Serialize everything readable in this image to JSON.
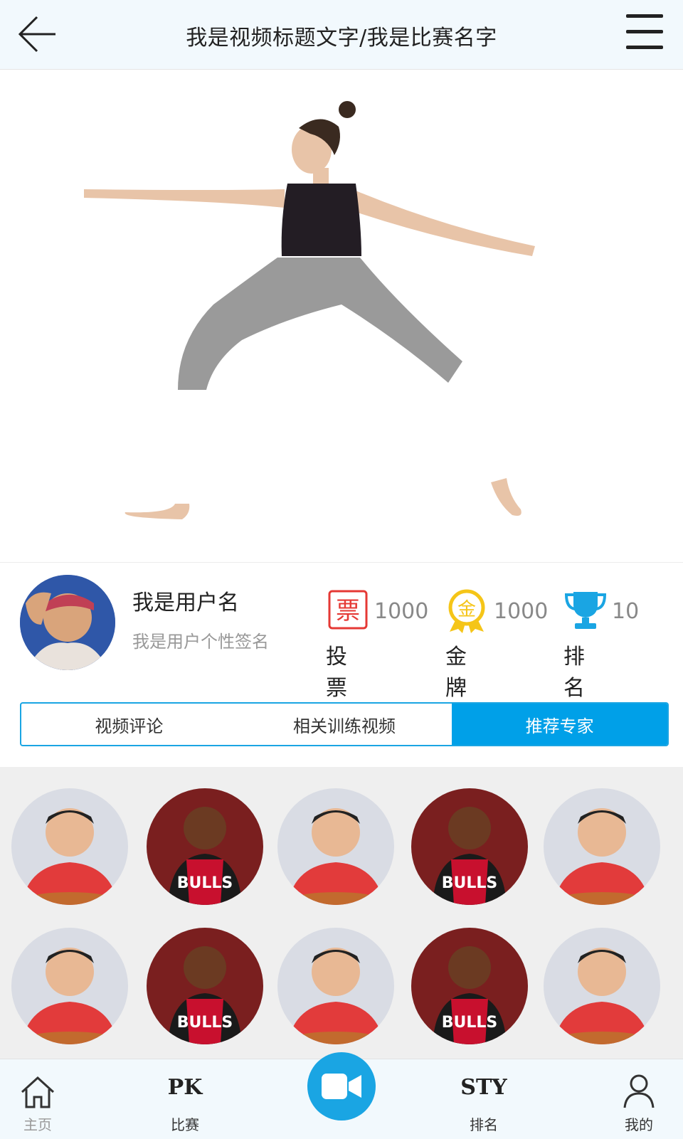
{
  "header": {
    "title": "我是视频标题文字/我是比赛名字",
    "back_icon": "arrow-left-icon",
    "menu_icon": "hamburger-menu-icon"
  },
  "user": {
    "name": "我是用户名",
    "signature": "我是用户个性签名"
  },
  "stats": {
    "votes": {
      "icon": "ticket-icon",
      "value": "1000",
      "label": "投票"
    },
    "gold": {
      "icon": "gold-medal-icon",
      "value": "1000",
      "label": "金牌"
    },
    "rank": {
      "icon": "trophy-icon",
      "value": "10",
      "label": "排名"
    }
  },
  "tabs": [
    {
      "label": "视频评论",
      "active": false
    },
    {
      "label": "相关训练视频",
      "active": false
    },
    {
      "label": "推荐专家",
      "active": true
    }
  ],
  "nav": {
    "home": {
      "label": "主页",
      "icon": "home-icon"
    },
    "pk": {
      "big": "PK",
      "label": "比赛"
    },
    "record": {
      "icon": "video-camera-icon"
    },
    "sty": {
      "big": "STY",
      "label": "排名"
    },
    "me": {
      "label": "我的",
      "icon": "user-icon"
    }
  },
  "colors": {
    "accent": "#00a0e8",
    "vote_red": "#e53935",
    "gold": "#f5c518",
    "trophy_blue": "#1aa5e3"
  }
}
